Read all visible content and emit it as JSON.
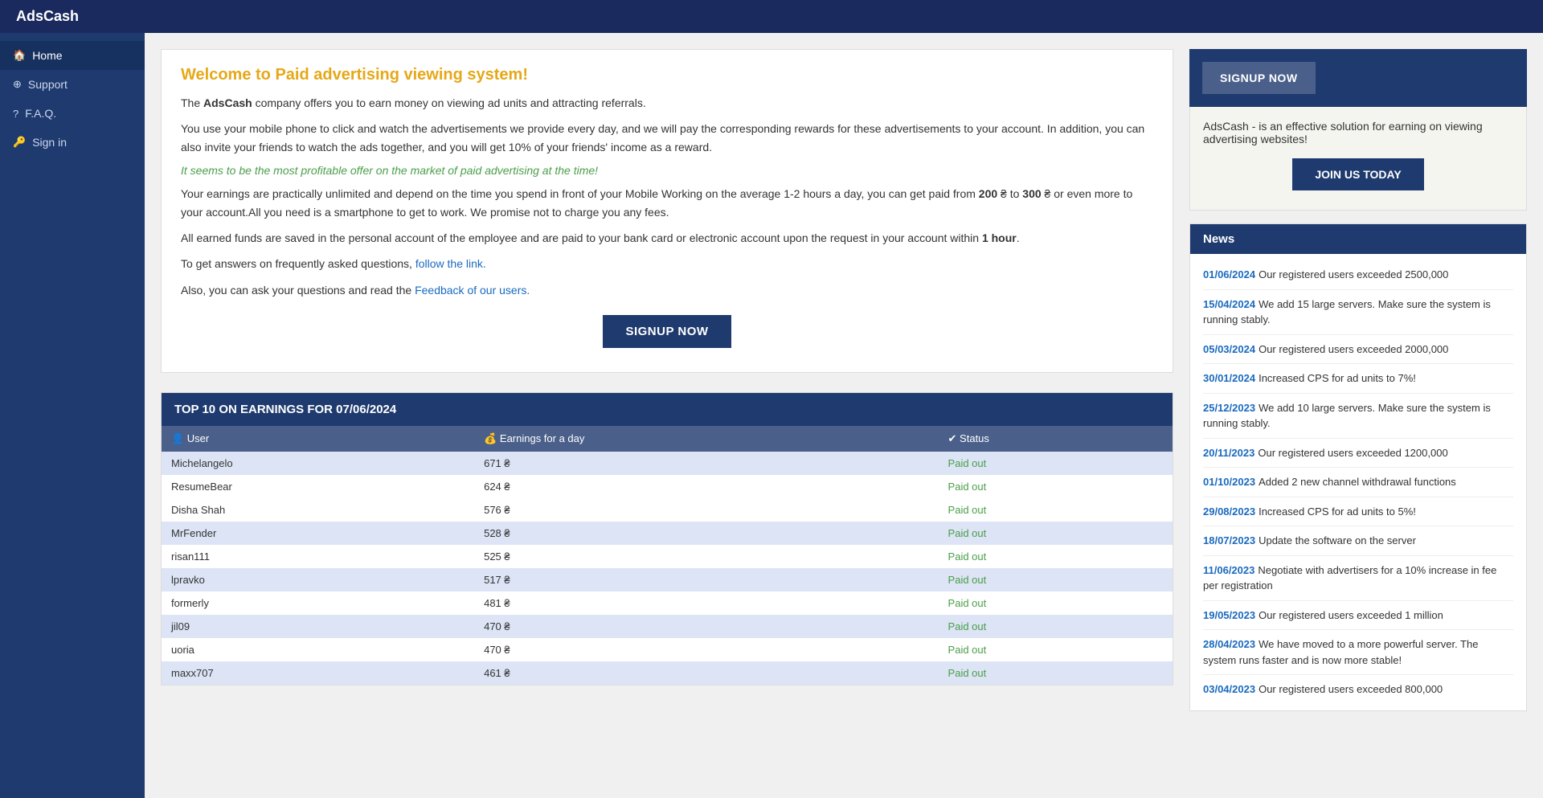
{
  "app": {
    "title": "AdsCash"
  },
  "sidebar": {
    "items": [
      {
        "id": "home",
        "label": "Home",
        "icon": "🏠",
        "active": true
      },
      {
        "id": "support",
        "label": "Support",
        "icon": "⊕"
      },
      {
        "id": "faq",
        "label": "F.A.Q.",
        "icon": "?"
      },
      {
        "id": "signin",
        "label": "Sign in",
        "icon": "🔑"
      }
    ]
  },
  "welcome": {
    "title_plain": "Welcome to ",
    "title_highlight": "Paid advertising viewing system!",
    "company_name": "AdsCash",
    "para1": "company offers you to earn money on viewing ad units and attracting referrals.",
    "para2": "You use your mobile phone to click and watch the advertisements we provide every day, and we will pay the corresponding rewards for these advertisements to your account. In addition, you can also invite your friends to watch the ads together, and you will get 10% of your friends' income as a reward.",
    "highlight_text": "It seems to be the most profitable offer on the market of paid advertising at the time!",
    "para3_start": "Your earnings are practically unlimited and depend on the time you spend in front of your Mobile Working on the average 1-2 hours a day, you can get paid from ",
    "amount1": "200",
    "sep": " to ",
    "amount2": "300",
    "para3_end": " or even more to your account.All you need is a smartphone to get to work. We promise not to charge you any fees.",
    "para4": "All earned funds are saved in the personal account of the employee and are paid to your bank card or electronic account upon the request in your account within ",
    "para4_bold": "1 hour",
    "para4_end": ".",
    "link_text1": "To get answers on frequently asked questions, ",
    "link1": "follow the link.",
    "link_text2": "Also, you can ask your questions and read the ",
    "link2": "Feedback of our users.",
    "signup_btn": "SIGNUP NOW"
  },
  "top10": {
    "header": "TOP 10 ON EARNINGS FOR 07/06/2024",
    "columns": {
      "user": "👤 User",
      "earnings": "💰 Earnings for a day",
      "status": "✔ Status"
    },
    "rows": [
      {
        "user": "Michelangelo",
        "earnings": "671 ₴",
        "status": "Paid out",
        "highlighted": true
      },
      {
        "user": "ResumeBear",
        "earnings": "624 ₴",
        "status": "Paid out",
        "highlighted": false
      },
      {
        "user": "Disha Shah",
        "earnings": "576 ₴",
        "status": "Paid out",
        "highlighted": false
      },
      {
        "user": "MrFender",
        "earnings": "528 ₴",
        "status": "Paid out",
        "highlighted": true
      },
      {
        "user": "risan111",
        "earnings": "525 ₴",
        "status": "Paid out",
        "highlighted": false
      },
      {
        "user": "lpravko",
        "earnings": "517 ₴",
        "status": "Paid out",
        "highlighted": true
      },
      {
        "user": "formerly",
        "earnings": "481 ₴",
        "status": "Paid out",
        "highlighted": false
      },
      {
        "user": "jil09",
        "earnings": "470 ₴",
        "status": "Paid out",
        "highlighted": true
      },
      {
        "user": "uoria",
        "earnings": "470 ₴",
        "status": "Paid out",
        "highlighted": false
      },
      {
        "user": "maxx707",
        "earnings": "461 ₴",
        "status": "Paid out",
        "highlighted": true
      }
    ]
  },
  "right_panel": {
    "signup_btn": "SIGNUP NOW",
    "desc": "AdsCash - is an effective solution for earning on viewing advertising websites!",
    "join_btn": "JOIN US TODAY",
    "news_header": "News",
    "news_items": [
      {
        "date": "01/06/2024",
        "text": "Our registered users exceeded 2500,000"
      },
      {
        "date": "15/04/2024",
        "text": "We add 15 large servers. Make sure the system is running stably."
      },
      {
        "date": "05/03/2024",
        "text": "Our registered users exceeded 2000,000"
      },
      {
        "date": "30/01/2024",
        "text": "Increased CPS for ad units to 7%!"
      },
      {
        "date": "25/12/2023",
        "text": "We add 10 large servers. Make sure the system is running stably."
      },
      {
        "date": "20/11/2023",
        "text": "Our registered users exceeded 1200,000"
      },
      {
        "date": "01/10/2023",
        "text": "Added 2 new channel withdrawal functions"
      },
      {
        "date": "29/08/2023",
        "text": "Increased CPS for ad units to 5%!"
      },
      {
        "date": "18/07/2023",
        "text": "Update the software on the server"
      },
      {
        "date": "11/06/2023",
        "text": "Negotiate with advertisers for a 10% increase in fee per registration"
      },
      {
        "date": "19/05/2023",
        "text": "Our registered users exceeded 1 million"
      },
      {
        "date": "28/04/2023",
        "text": "We have moved to a more powerful server. The system runs faster and is now more stable!"
      },
      {
        "date": "03/04/2023",
        "text": "Our registered users exceeded 800,000"
      }
    ]
  }
}
